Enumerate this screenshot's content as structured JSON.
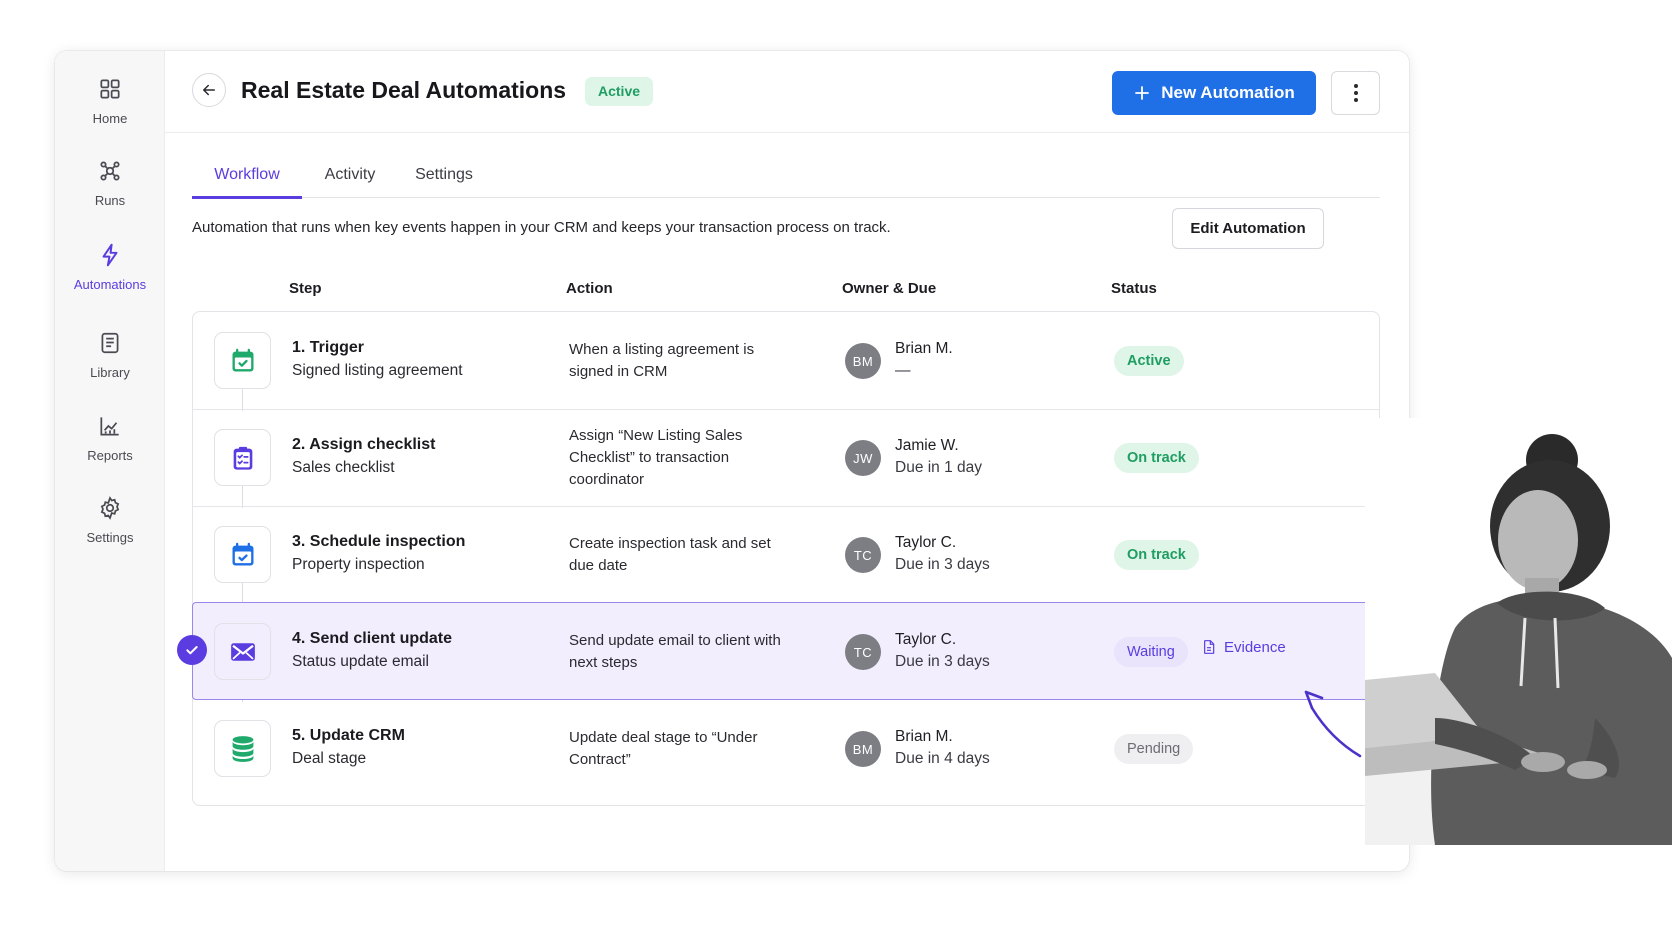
{
  "sidebar": {
    "items": [
      {
        "label": "Home",
        "icon": "grid-icon",
        "active": false
      },
      {
        "label": "Runs",
        "icon": "runs-icon",
        "active": false
      },
      {
        "label": "Automations",
        "icon": "lightning-icon",
        "active": true
      },
      {
        "label": "Library",
        "icon": "library-icon",
        "active": false
      },
      {
        "label": "Reports",
        "icon": "reports-icon",
        "active": false
      },
      {
        "label": "Settings",
        "icon": "gear-icon",
        "active": false
      }
    ]
  },
  "header": {
    "title": "Real Estate Deal Automations",
    "badge": "Active",
    "primary_button": "New Automation"
  },
  "tabs": [
    {
      "label": "Workflow",
      "active": true
    },
    {
      "label": "Activity",
      "active": false
    },
    {
      "label": "Settings",
      "active": false
    }
  ],
  "description": "Automation that runs when key events happen in your CRM and keeps your transaction process on track.",
  "edit_button": "Edit Automation",
  "table": {
    "headers": {
      "step": "Step",
      "action": "Action",
      "owner": "Owner & Due",
      "status": "Status"
    },
    "rows": [
      {
        "title": "1. Trigger",
        "subtitle": "Signed listing agreement",
        "action": "When a listing agreement is signed in CRM",
        "initials": "BM",
        "owner": "Brian M.",
        "due": "—",
        "status": "Active",
        "status_style": "green",
        "icon": "calendar-check-icon"
      },
      {
        "title": "2. Assign checklist",
        "subtitle": "Sales checklist",
        "action": "Assign “New Listing Sales Checklist” to transaction coordinator",
        "initials": "JW",
        "owner": "Jamie W.",
        "due": "Due in 1 day",
        "status": "On track",
        "status_style": "green",
        "icon": "clipboard-icon"
      },
      {
        "title": "3. Schedule inspection",
        "subtitle": "Property inspection",
        "action": "Create inspection task and set due date",
        "initials": "TC",
        "owner": "Taylor C.",
        "due": "Due in 3 days",
        "status": "On track",
        "status_style": "green",
        "icon": "calendar-icon"
      },
      {
        "title": "4. Send client update",
        "subtitle": "Status update email",
        "action": "Send update email to client with next steps",
        "initials": "TC",
        "owner": "Taylor C.",
        "due": "Due in 3 days",
        "status": "Waiting",
        "status_style": "purple",
        "icon": "mail-icon",
        "selected": true,
        "link": "Evidence"
      },
      {
        "title": "5. Update CRM",
        "subtitle": "Deal stage",
        "action": "Update deal stage to “Under Contract”",
        "initials": "BM",
        "owner": "Brian M.",
        "due": "Due in 4 days",
        "status": "Pending",
        "status_style": "grey",
        "icon": "database-icon"
      }
    ]
  },
  "colors": {
    "accent": "#5b3ce0",
    "primary": "#1f6fe6",
    "success": "#1f9d62"
  }
}
